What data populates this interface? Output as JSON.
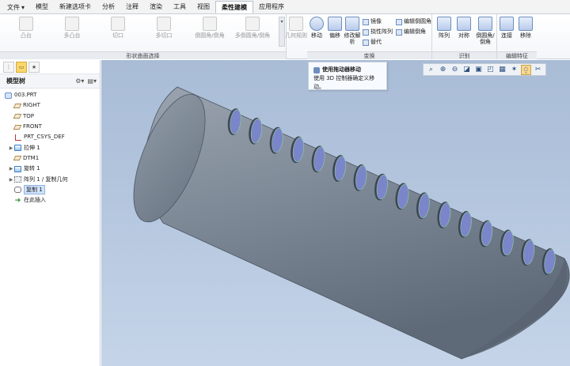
{
  "menu": {
    "tabs": [
      {
        "label": "文件",
        "arrow": "▾"
      },
      {
        "label": "模型"
      },
      {
        "label": "新建选项卡"
      },
      {
        "label": "分析"
      },
      {
        "label": "注释"
      },
      {
        "label": "渲染"
      },
      {
        "label": "工具"
      },
      {
        "label": "视图"
      },
      {
        "label": "柔性建模",
        "active": true
      },
      {
        "label": "应用程序"
      }
    ]
  },
  "ribbon": {
    "shape_surface": {
      "label": "形状曲面选择",
      "buttons": [
        "凸台",
        "多凸台",
        "切口",
        "多切口",
        "倒圆角/倒角",
        "多倒圆角/倒角",
        "几何规则"
      ]
    },
    "transform": {
      "label": "变换",
      "move_label": "移动",
      "offset_label": "偏移",
      "modify_label": "修改解析",
      "small": [
        "镜像",
        "挠性阵列",
        "替代",
        "编辑倒圆角",
        "编辑倒角"
      ]
    },
    "recognize": {
      "label": "识别",
      "buttons": [
        "阵列",
        "对称",
        "倒圆角/倒角"
      ]
    },
    "edit_feature": {
      "label": "编辑特征",
      "buttons": [
        "连接",
        "移除"
      ]
    },
    "scroll_glyph": "▾"
  },
  "tooltip": {
    "title": "使用拖动器移动",
    "body": "使用 3D 控制器确定义移动。"
  },
  "model_tree": {
    "header": "模型树",
    "items": [
      {
        "label": "003.PRT",
        "icon": "part-icon"
      },
      {
        "label": "RIGHT",
        "icon": "plane-icon"
      },
      {
        "label": "TOP",
        "icon": "plane-icon"
      },
      {
        "label": "FRONT",
        "icon": "plane-icon"
      },
      {
        "label": "PRT_CSYS_DEF",
        "icon": "csys-icon"
      },
      {
        "label": "拉伸 1",
        "icon": "extrude-icon",
        "expand": "▶"
      },
      {
        "label": "DTM1",
        "icon": "plane-icon"
      },
      {
        "label": "旋转 1",
        "icon": "revolve-icon",
        "expand": "▶"
      },
      {
        "label": "阵列 1 / 复制几何",
        "icon": "pattern-icon",
        "expand": "▶"
      },
      {
        "label": "复制 1",
        "icon": "copy-icon",
        "selected": true
      },
      {
        "label": "在此插入",
        "icon": "insert-icon"
      }
    ]
  },
  "view_toolbar": [
    "⌕",
    "⊕",
    "⊖",
    "◪",
    "▣",
    "◰",
    "▦",
    "✶",
    "⍜",
    "✂"
  ],
  "colors": {
    "accent": "#6d8fbf",
    "cylinder_body": "#7f8a98",
    "slot_fill": "#7b85c9",
    "viewport_bg": "#b4c6de"
  }
}
